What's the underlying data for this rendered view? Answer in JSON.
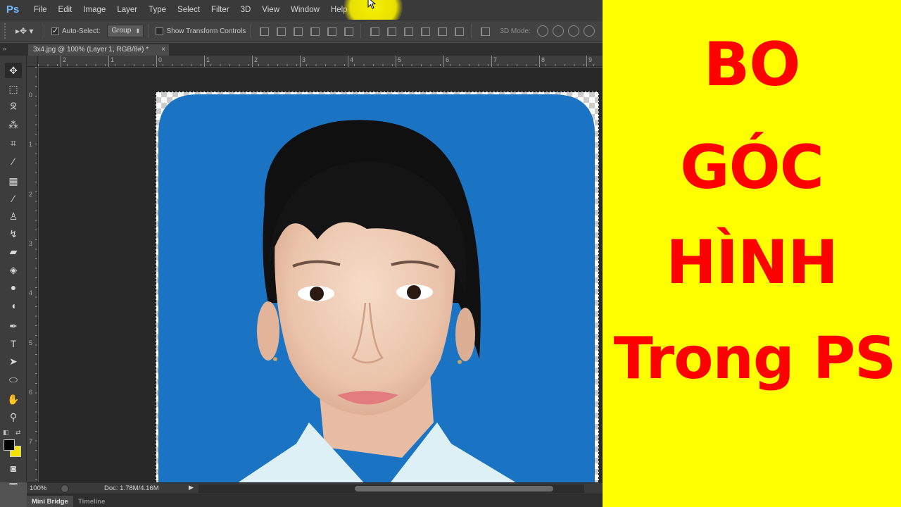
{
  "app": {
    "logo": "Ps"
  },
  "menu": [
    "File",
    "Edit",
    "Image",
    "Layer",
    "Type",
    "Select",
    "Filter",
    "3D",
    "View",
    "Window",
    "Help"
  ],
  "options_bar": {
    "tool_icon": "move-tool-icon",
    "auto_select_label": "Auto-Select:",
    "auto_select_checked": true,
    "auto_select_mode": "Group",
    "show_transform_label": "Show Transform Controls",
    "show_transform_checked": false,
    "mode_3d_label": "3D Mode:"
  },
  "document_tab": {
    "title": "3x4.jpg @ 100% (Layer 1, RGB/8#) *",
    "close": "×"
  },
  "ruler_top": [
    "2",
    "1",
    "0",
    "1",
    "2",
    "3",
    "4",
    "5",
    "6",
    "7",
    "8",
    "9"
  ],
  "ruler_left": [
    "0",
    "1",
    "2",
    "3",
    "4",
    "5",
    "6",
    "7"
  ],
  "tools": [
    "move-tool",
    "marquee-tool",
    "lasso-tool",
    "magic-wand-tool",
    "crop-tool",
    "eyedropper-tool",
    "healing-brush-tool",
    "brush-tool",
    "clone-stamp-tool",
    "history-brush-tool",
    "eraser-tool",
    "paint-bucket-tool",
    "blur-tool",
    "dodge-tool",
    "pen-tool",
    "type-tool",
    "path-selection-tool",
    "ellipse-tool",
    "hand-tool",
    "zoom-tool",
    "quick-mask-tool",
    "screen-mode-tool"
  ],
  "colors": {
    "foreground": "#000000",
    "background": "#f2e400",
    "photo_background": "#1a73c2",
    "title_bg": "#ffff00",
    "title_text": "#ff0000"
  },
  "status": {
    "zoom": "100%",
    "doc_info": "Doc: 1.78M/4.16M"
  },
  "bottom_panel": {
    "tabs": [
      "Mini Bridge",
      "Timeline"
    ]
  },
  "title": {
    "line1": "BO",
    "line2": "GÓC",
    "line3": "HÌNH",
    "line4": "Trong PS"
  }
}
